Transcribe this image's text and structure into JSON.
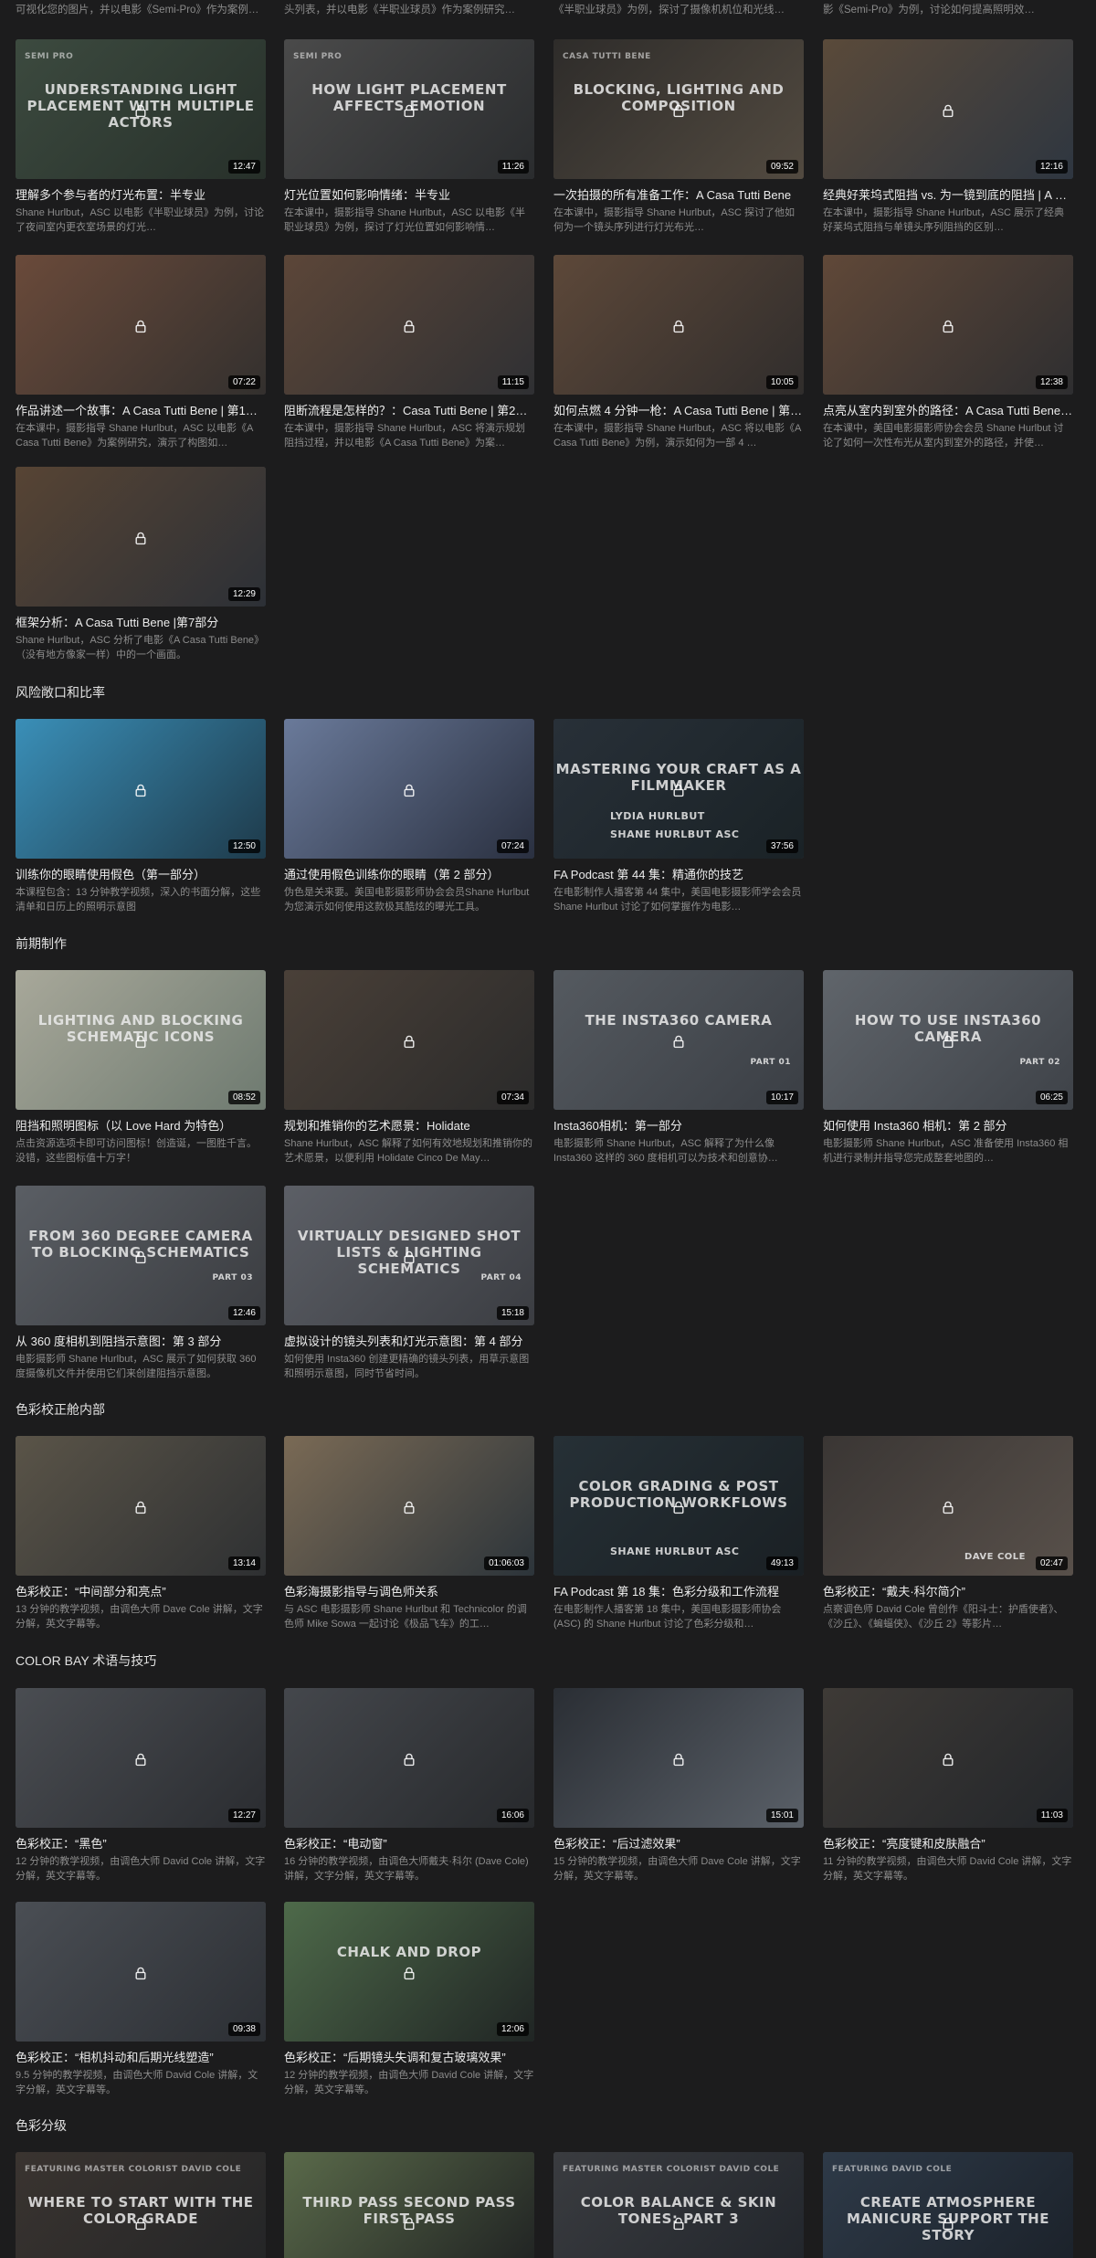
{
  "top_partial": [
    "可视化您的图片，并以电影《Semi-Pro》作为案例…",
    "头列表，并以电影《半职业球员》作为案例研究…",
    "《半职业球员》为例，探讨了摄像机机位和光线…",
    "影《Semi-Pro》为例，讨论如何提高照明效…"
  ],
  "sections": [
    {
      "title": "",
      "cards": [
        {
          "title": "理解多个参与者的灯光布置：半专业",
          "desc": "Shane Hurlbut，ASC 以电影《半职业球员》为例，讨论了夜间室内更衣室场景的灯光…",
          "duration": "12:47",
          "thumb_text": "Understanding Light Placement with Multiple Actors",
          "series": "SEMI PRO"
        },
        {
          "title": "灯光位置如何影响情绪：半专业",
          "desc": "在本课中，摄影指导 Shane Hurlbut，ASC 以电影《半职业球员》为例，探讨了灯光位置如何影响情…",
          "duration": "11:26",
          "thumb_text": "How Light Placement Affects Emotion",
          "series": "SEMI PRO"
        },
        {
          "title": "一次拍摄的所有准备工作：A Casa Tutti Bene",
          "desc": "在本课中，摄影指导 Shane Hurlbut，ASC 探讨了他如何为一个镜头序列进行灯光布光…",
          "duration": "09:52",
          "thumb_text": "Blocking, Lighting and Composition",
          "series": "Casa Tutti Bene"
        },
        {
          "title": "经典好莱坞式阻挡 vs. 为一镜到底的阻挡 | A Casa Tutti Bene",
          "desc": "在本课中，摄影指导 Shane Hurlbut，ASC 展示了经典好莱坞式阻挡与单镜头序列阻挡的区别…",
          "duration": "12:16"
        }
      ]
    },
    {
      "title": "",
      "cards": [
        {
          "title": "作品讲述一个故事：A Casa Tutti Bene | 第1部分",
          "desc": "在本课中，摄影指导 Shane Hurlbut，ASC 以电影《A Casa Tutti Bene》为案例研究，演示了构图如…",
          "duration": "07:22"
        },
        {
          "title": "阻断流程是怎样的？：Casa Tutti Bene | 第2部分",
          "desc": "在本课中，摄影指导 Shane Hurlbut，ASC 将演示规划阻挡过程，并以电影《A Casa Tutti Bene》为案…",
          "duration": "11:15"
        },
        {
          "title": "如何点燃 4 分钟一枪：A Casa Tutti Bene | 第3部分",
          "desc": "在本课中，摄影指导 Shane Hurlbut，ASC 将以电影《A Casa Tutti Bene》为例，演示如何为一部 4 …",
          "duration": "10:05"
        },
        {
          "title": "点亮从室内到室外的路径：A Casa Tutti Bene | 第4部分",
          "desc": "在本课中，美国电影摄影师协会会员 Shane Hurlbut 讨论了如何一次性布光从室内到室外的路径，并使…",
          "duration": "12:38"
        }
      ]
    },
    {
      "title": "",
      "cards": [
        {
          "title": "框架分析：A Casa Tutti Bene |第7部分",
          "desc": "Shane Hurlbut，ASC 分析了电影《A Casa Tutti Bene》（没有地方像家一样）中的一个画面。",
          "duration": "12:29"
        }
      ]
    },
    {
      "title": "风险敞口和比率",
      "cards": [
        {
          "title": "训练你的眼睛使用假色（第一部分）",
          "desc": "本课程包含：13 分钟教学视频，深入的书面分解，这些清单和日历上的照明示意图",
          "duration": "12:50"
        },
        {
          "title": "通过使用假色训练你的眼睛（第 2 部分）",
          "desc": "伪色是关来要。美国电影摄影师协会会员Shane Hurlbut 为您演示如何使用这款极其酷炫的曝光工具。",
          "duration": "07:24"
        },
        {
          "title": "FA Podcast 第 44 集：精通你的技艺",
          "desc": "在电影制作人播客第 44 集中，美国电影摄影师学会会员 Shane Hurlbut 讨论了如何掌握作为电影…",
          "duration": "37:56",
          "thumb_text": "Mastering Your Craft as a Filmmaker",
          "guest1": "LYDIA HURLBUT",
          "guest2": "SHANE HURLBUT ASC"
        }
      ]
    },
    {
      "title": "前期制作",
      "cards": [
        {
          "title": "阻挡和照明图标（以 Love Hard 为特色）",
          "desc": "点击资源选项卡即可访问图标！创造诞，一图胜千言。没错，这些图标值十万字！",
          "duration": "08:52",
          "thumb_text": "Lighting and Blocking Schematic Icons"
        },
        {
          "title": "规划和推销你的艺术愿景：Holidate",
          "desc": "Shane Hurlbut，ASC 解释了如何有效地规划和推销你的艺术愿景，以便利用 Holidate Cinco De May…",
          "duration": "07:34"
        },
        {
          "title": "Insta360相机：第一部分",
          "desc": "电影摄影师 Shane Hurlbut，ASC 解释了为什么像 Insta360 这样的 360 度相机可以为技术和创意协…",
          "duration": "10:17",
          "thumb_text": "The Insta360 Camera",
          "part": "PART 01"
        },
        {
          "title": "如何使用 Insta360 相机：第 2 部分",
          "desc": "电影摄影师 Shane Hurlbut，ASC 准备使用 Insta360 相机进行录制并指导您完成整套地图的…",
          "duration": "06:25",
          "thumb_text": "How to Use Insta360 Camera",
          "part": "PART 02"
        }
      ]
    },
    {
      "title": "",
      "cards": [
        {
          "title": "从 360 度相机到阻挡示意图：第 3 部分",
          "desc": "电影摄影师 Shane Hurlbut，ASC 展示了如何获取 360 度摄像机文件并使用它们来创建阻挡示意图。",
          "duration": "12:46",
          "thumb_text": "From 360 Degree Camera to Blocking Schematics",
          "part": "PART 03"
        },
        {
          "title": "虚拟设计的镜头列表和灯光示意图：第 4 部分",
          "desc": "如何使用 Insta360 创建更精确的镜头列表，用草示意图和照明示意图，同时节省时间。",
          "duration": "15:18",
          "thumb_text": "Virtually Designed Shot Lists & Lighting Schematics",
          "part": "PART 04"
        }
      ]
    },
    {
      "title": "色彩校正舱内部",
      "cards": [
        {
          "title": "色彩校正：“中间部分和亮点”",
          "desc": "13 分钟的教学视频，由调色大师 Dave Cole 讲解，文字分解，英文字幕等。",
          "duration": "13:14"
        },
        {
          "title": "色彩海摄影指导与调色师关系",
          "desc": "与 ASC 电影摄影师 Shane Hurlbut 和 Technicolor 的调色师 Mike Sowa 一起讨论《极品飞车》的工…",
          "duration": "01:06:03"
        },
        {
          "title": "FA Podcast 第 18 集：色彩分级和工作流程",
          "desc": "在电影制作人播客第 18 集中，美国电影摄影师协会 (ASC) 的 Shane Hurlbut 讨论了色彩分级和…",
          "duration": "49:13",
          "thumb_text": "Color Grading & Post Production Workflows",
          "guest2": "SHANE HURLBUT ASC"
        },
        {
          "title": "色彩校正：“戴夫·科尔简介”",
          "desc": "点察调色师 David Cole 曾创作《阳斗士：护盾使者》、《沙丘》、《蝙蝠侠》、《沙丘 2》等影片…",
          "duration": "02:47",
          "name_tag": "DAVE COLE"
        }
      ]
    },
    {
      "title": "COLOR BAY 术语与技巧",
      "cards": [
        {
          "title": "色彩校正：“黑色”",
          "desc": "12 分钟的教学视频，由调色大师 David Cole 讲解，文字分解，英文字幕等。",
          "duration": "12:27"
        },
        {
          "title": "色彩校正：“电动窗”",
          "desc": "16 分钟的教学视频，由调色大师戴夫·科尔 (Dave Cole) 讲解，文字分解，英文字幕等。",
          "duration": "16:06"
        },
        {
          "title": "色彩校正：“后过滤效果”",
          "desc": "15 分钟的教学视频，由调色大师 Dave Cole 讲解，文字分解，英文字幕等。",
          "duration": "15:01"
        },
        {
          "title": "色彩校正：“亮度键和皮肤融合”",
          "desc": "11 分钟的教学视频，由调色大师 David Cole 讲解，文字分解，英文字幕等。",
          "duration": "11:03"
        }
      ]
    },
    {
      "title": "",
      "cards": [
        {
          "title": "色彩校正：“相机抖动和后期光线塑造”",
          "desc": "9.5 分钟的教学视频，由调色大师 David Cole 讲解，文字分解，英文字幕等。",
          "duration": "09:38"
        },
        {
          "title": "色彩校正：“后期镜头失调和复古玻璃效果”",
          "desc": "12 分钟的教学视频，由调色大师 David Cole 讲解，文字分解，英文字幕等。",
          "duration": "12:06",
          "thumb_text": "Chalk and Drop"
        }
      ]
    },
    {
      "title": "色彩分级",
      "cards": [
        {
          "title": "",
          "desc": "",
          "duration": "",
          "thumb_text": "Where to Start with the Color Grade",
          "series": "FEATURING MASTER COLORIST DAVID COLE"
        },
        {
          "title": "",
          "desc": "",
          "duration": "",
          "thumb_text": "Third Pass Second Pass First Pass"
        },
        {
          "title": "",
          "desc": "",
          "duration": "",
          "thumb_text": "Color Balance & Skin Tones: Part 3",
          "series": "FEATURING MASTER COLORIST DAVID COLE"
        },
        {
          "title": "",
          "desc": "",
          "duration": "",
          "thumb_text": "Create Atmosphere Manicure Support the Story",
          "series": "FEATURING DAVID COLE"
        }
      ]
    }
  ]
}
